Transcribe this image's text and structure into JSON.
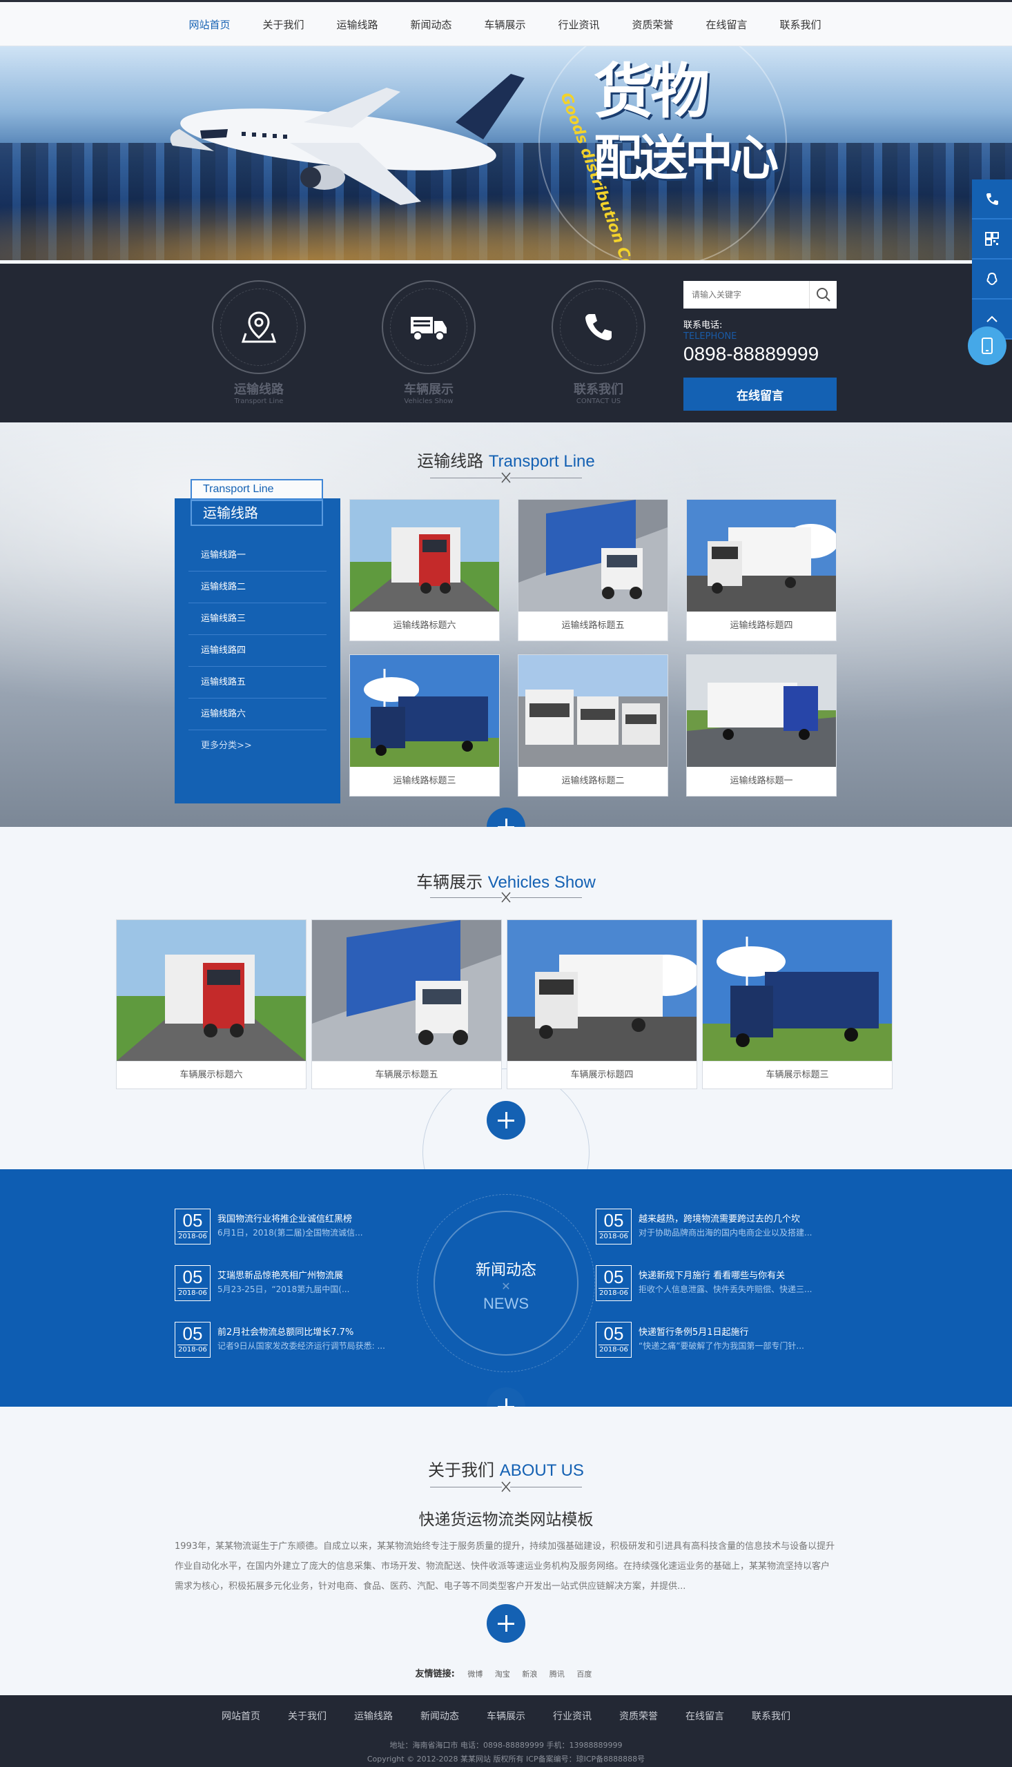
{
  "nav": {
    "items": [
      "网站首页",
      "关于我们",
      "运输线路",
      "新闻动态",
      "车辆展示",
      "行业资讯",
      "资质荣誉",
      "在线留言",
      "联系我们"
    ]
  },
  "banner": {
    "title_line1": "货物",
    "title_line2": "配送中心",
    "subtitle_en": "Goods distribution Center"
  },
  "quick": {
    "items": [
      {
        "title": "运输线路",
        "sub": "Transport Line"
      },
      {
        "title": "车辆展示",
        "sub": "Vehicles Show"
      },
      {
        "title": "联系我们",
        "sub": "CONTACT US"
      }
    ],
    "search_placeholder": "请输入关键字",
    "contact_label": "联系电话:",
    "contact_en": "TELEPHONE",
    "phone": "0898-88889999",
    "message_button": "在线留言"
  },
  "transport": {
    "title_cn": "运输线路",
    "title_en": "Transport Line",
    "tag_en": "Transport Line",
    "tag_cn": "运输线路",
    "categories": [
      "运输线路一",
      "运输线路二",
      "运输线路三",
      "运输线路四",
      "运输线路五",
      "运输线路六"
    ],
    "more": "更多分类>>",
    "cards": [
      "运输线路标题六",
      "运输线路标题五",
      "运输线路标题四",
      "运输线路标题三",
      "运输线路标题二",
      "运输线路标题一"
    ]
  },
  "vehicles": {
    "title_cn": "车辆展示",
    "title_en": "Vehicles Show",
    "cards": [
      "车辆展示标题六",
      "车辆展示标题五",
      "车辆展示标题四",
      "车辆展示标题三"
    ]
  },
  "news": {
    "center_cn": "新闻动态",
    "center_x": "✕",
    "center_en": "NEWS",
    "items": [
      {
        "day": "05",
        "month": "2018-06",
        "title": "我国物流行业将推企业诚信红黑榜",
        "desc": "6月1日，2018(第二届)全国物流诚信..."
      },
      {
        "day": "05",
        "month": "2018-06",
        "title": "艾瑞思新品惊艳亮相广州物流展",
        "desc": "5月23-25日，“2018第九届中国(..."
      },
      {
        "day": "05",
        "month": "2018-06",
        "title": "前2月社会物流总额同比增长7.7%",
        "desc": "记者9日从国家发改委经济运行调节局获悉: ..."
      },
      {
        "day": "05",
        "month": "2018-06",
        "title": "越来越热，跨境物流需要跨过去的几个坎",
        "desc": "对于协助品牌商出海的国内电商企业以及搭建..."
      },
      {
        "day": "05",
        "month": "2018-06",
        "title": "快递新规下月施行 看看哪些与你有关",
        "desc": "拒收个人信息泄露、快件丢失咋赔偿、快递三..."
      },
      {
        "day": "05",
        "month": "2018-06",
        "title": "快递暂行条例5月1日起施行",
        "desc": "“快递之痛”要破解了作为我国第一部专门针..."
      }
    ]
  },
  "about": {
    "title_cn": "关于我们",
    "title_en": "ABOUT US",
    "heading": "快递货运物流类网站模板",
    "paragraph": "1993年，某某物流诞生于广东顺德。自成立以来，某某物流始终专注于服务质量的提升，持续加强基础建设，积极研发和引进具有高科技含量的信息技术与设备以提升作业自动化水平，在国内外建立了庞大的信息采集、市场开发、物流配送、快件收派等速运业务机构及服务网络。在持续强化速运业务的基础上，某某物流坚持以客户需求为核心，积极拓展多元化业务，针对电商、食品、医药、汽配、电子等不同类型客户开发出一站式供应链解决方案，并提供..."
  },
  "links": {
    "label": "友情链接:",
    "items": [
      "微博",
      "淘宝",
      "新浪",
      "腾讯",
      "百度"
    ]
  },
  "footer": {
    "nav": [
      "网站首页",
      "关于我们",
      "运输线路",
      "新闻动态",
      "车辆展示",
      "行业资讯",
      "资质荣誉",
      "在线留言",
      "联系我们"
    ],
    "info": "地址：海南省海口市    电话：0898-88889999    手机：13988889999",
    "copyright": "Copyright © 2012-2028 某某网站 版权所有    ICP备案编号：琼ICP备8888888号"
  },
  "colors": {
    "accent": "#1461b3",
    "dark": "#232834"
  }
}
